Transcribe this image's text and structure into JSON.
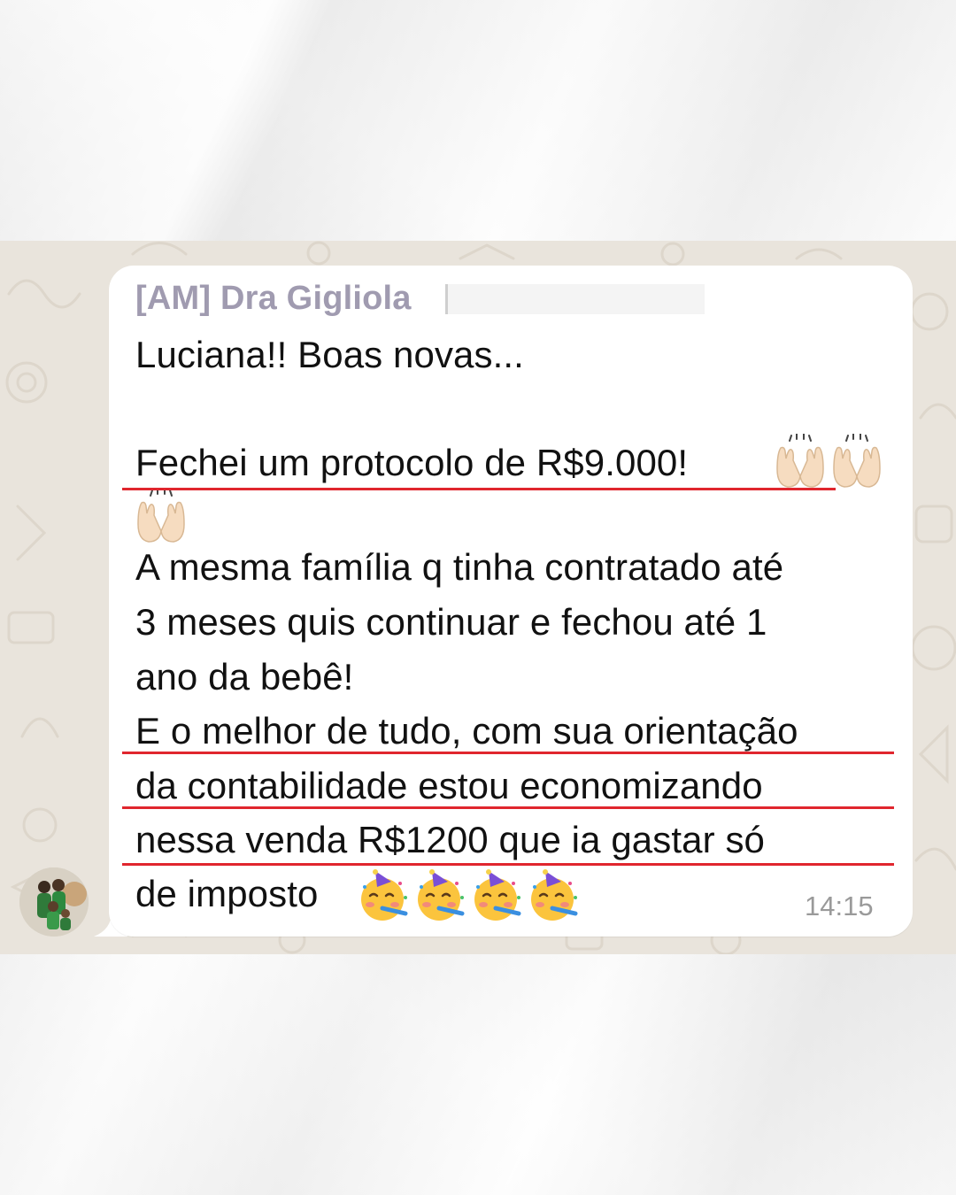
{
  "message": {
    "sender": "[AM] Dra Gigliola",
    "lines": [
      "Luciana!! Boas novas...",
      "Fechei um protocolo de R$9.000!",
      "A mesma família q tinha contratado até",
      "3 meses quis continuar e fechou até 1",
      "ano da bebê!",
      "E o melhor de tudo, com sua orientação",
      "da contabilidade estou economizando",
      "nessa venda R$1200 que ia gastar só",
      "de imposto"
    ],
    "timestamp": "14:15",
    "emojis": {
      "raised_hands": "raising-hands-emoji",
      "party_face": "partying-face-emoji"
    }
  },
  "colors": {
    "sender_name": "#a09bb0",
    "underline": "#e0262e",
    "wallpaper": "#e9e4dc",
    "bubble": "#ffffff",
    "timestamp": "#9a9a9a"
  }
}
